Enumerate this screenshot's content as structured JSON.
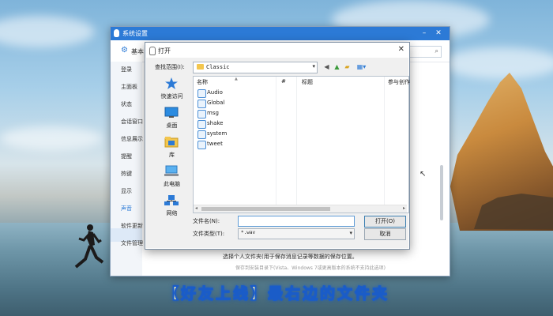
{
  "settings_window": {
    "title": "系统设置",
    "header_label": "基本",
    "sidebar_items": [
      "登录",
      "主面板",
      "状态",
      "会话窗口",
      "信息展示",
      "提醒",
      "热键",
      "显示",
      "声音",
      "软件更新",
      "文件管理"
    ],
    "active_item": "声音",
    "body_text": "选择个人文件夹(用于保存消息记录等数据的保存位置。",
    "body_hint": "保存到安装目录下(Vista、Windows 7或更高版本的系统不支持此选项)"
  },
  "open_dialog": {
    "title": "打开",
    "look_in_label": "查找范围(I):",
    "look_in_value": "Classic",
    "places": [
      {
        "label": "快速访问",
        "icon": "star-icon"
      },
      {
        "label": "桌面",
        "icon": "desktop-icon"
      },
      {
        "label": "库",
        "icon": "library-icon"
      },
      {
        "label": "此电脑",
        "icon": "computer-icon"
      },
      {
        "label": "网络",
        "icon": "network-icon"
      }
    ],
    "columns": [
      "名称",
      "#",
      "标题",
      "参与创作"
    ],
    "files": [
      "Audio",
      "Global",
      "msg",
      "shake",
      "system",
      "tweet"
    ],
    "filename_label": "文件名(N):",
    "filename_value": "",
    "filetype_label": "文件类型(T):",
    "filetype_value": "*.wav",
    "open_button": "打开(O)",
    "cancel_button": "取消"
  },
  "caption": "【好友上线】最右边的文件夹",
  "colors": {
    "accent": "#2c7ad6",
    "caption_fill": "#fff8b0",
    "caption_stroke": "#1a5cc8"
  }
}
